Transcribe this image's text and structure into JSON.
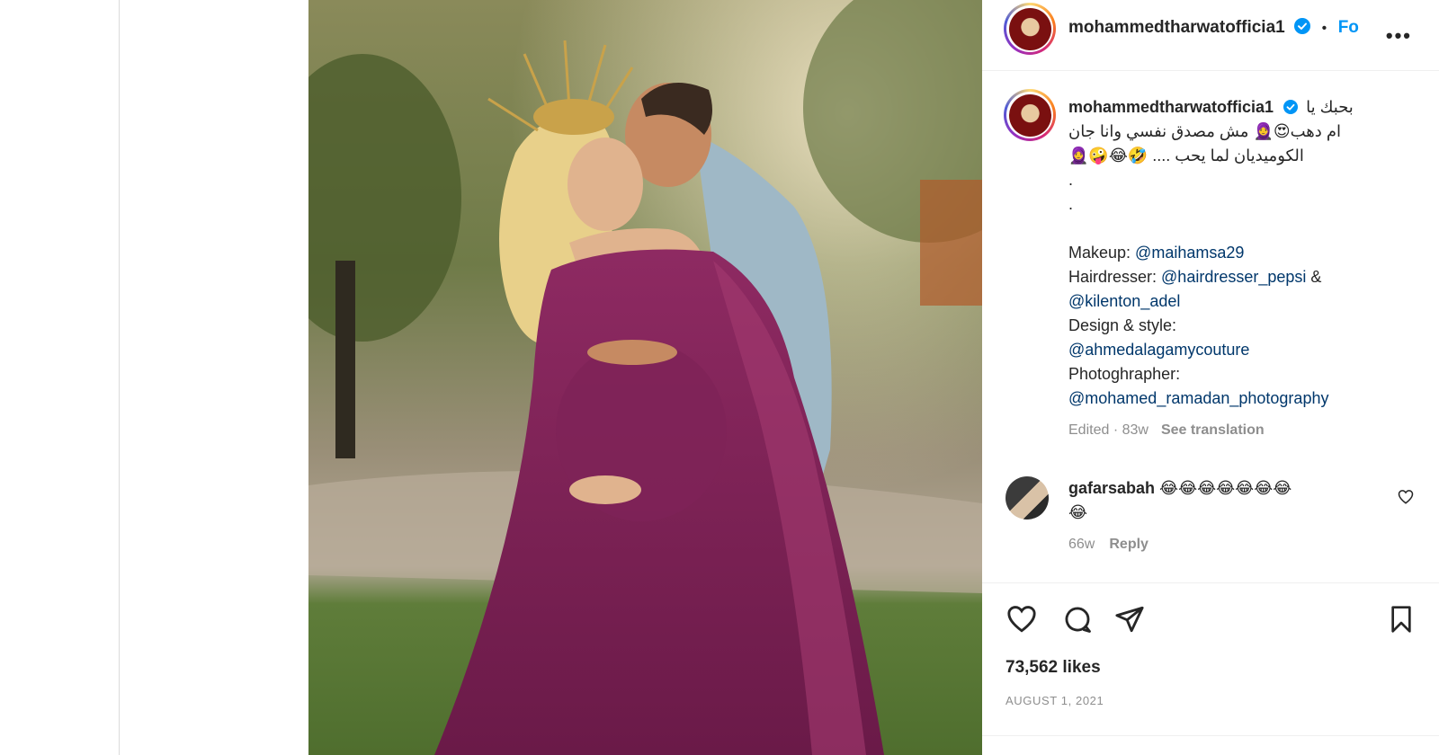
{
  "post": {
    "username": "mohammedtharwatofficia1",
    "follow_label": "Fo",
    "more_label": "•••",
    "caption": {
      "line1": "بحبك يا",
      "line2": "ام دهب😍🧕 مش مصدق نفسي وانا جان",
      "line3": "الكوميديان لما يحب .... 🤣😂🤪🧕",
      "dot1": ".",
      "dot2": ".",
      "makeup_label": "Makeup: ",
      "makeup_mention": "@maihamsa29",
      "hair_label": "Hairdresser: ",
      "hair_mention1": "@hairdresser_pepsi",
      "hair_amp": " &",
      "hair_mention2": "@kilenton_adel",
      "design_label": "Design & style:",
      "design_mention": "@ahmedalagamycouture",
      "photo_label": "Photoghrapher:",
      "photo_mention": "@mohamed_ramadan_photography"
    },
    "meta": {
      "edited": "Edited · 83w",
      "see_translation": "See translation"
    },
    "comment": {
      "username": "gafarsabah",
      "text": " 😂😂😂😂😂😂😂",
      "text2": "😂",
      "time": "66w",
      "reply": "Reply"
    },
    "likes": "73,562 likes",
    "date": "AUGUST 1, 2021"
  },
  "colors": {
    "link": "#00376b",
    "follow": "#0095f6",
    "muted": "#8e8e8e",
    "verified": "#0095f6"
  },
  "icons": {
    "like": "heart-icon",
    "comment": "comment-icon",
    "share": "paper-plane-icon",
    "save": "bookmark-icon",
    "next": "chevron-right-icon",
    "verified": "verified-badge-icon"
  }
}
